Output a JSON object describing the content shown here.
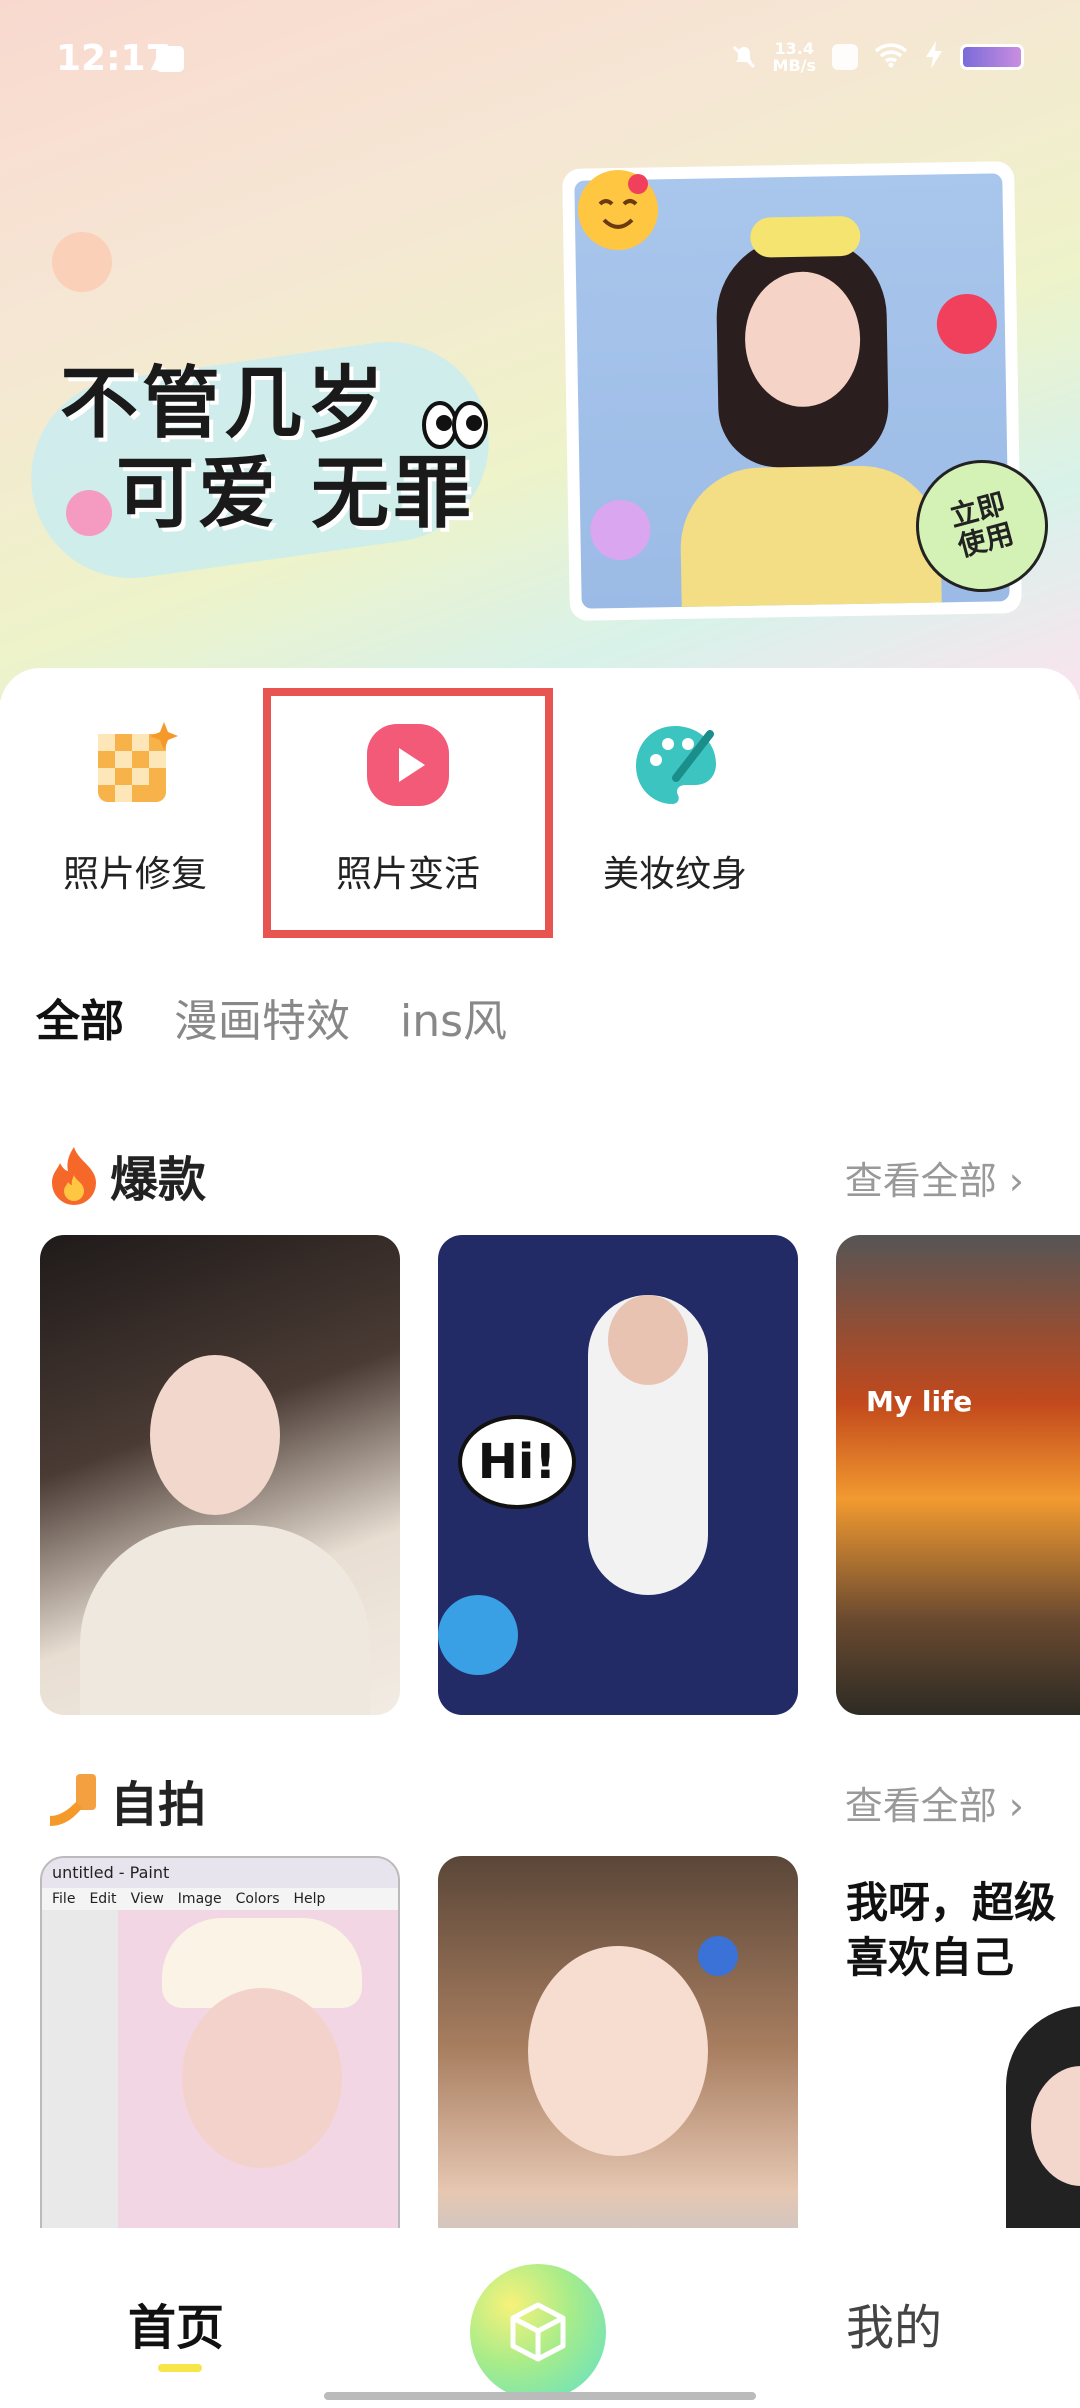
{
  "status_bar": {
    "time": "12:17",
    "net_speed_value": "13.4",
    "net_speed_unit": "MB/s"
  },
  "banner": {
    "slogan_line1": "不管几岁",
    "slogan_line2": "可爱 无罪",
    "cta_line1": "立即",
    "cta_line2": "使用"
  },
  "tools": [
    {
      "label": "照片修复",
      "icon": "photo-repair-icon"
    },
    {
      "label": "照片变活",
      "icon": "play-icon"
    },
    {
      "label": "美妆纹身",
      "icon": "palette-icon"
    }
  ],
  "tabs": [
    {
      "label": "全部",
      "active": true
    },
    {
      "label": "漫画特效",
      "active": false
    },
    {
      "label": "ins风",
      "active": false
    }
  ],
  "sections": [
    {
      "title": "爆款",
      "icon": "fire-icon",
      "more": "查看全部",
      "cards": [
        {
          "caption": ""
        },
        {
          "caption": "Hi!"
        },
        {
          "caption": "My life"
        }
      ]
    },
    {
      "title": "自拍",
      "icon": "selfie-icon",
      "more": "查看全部",
      "cards": [
        {
          "caption": "untitled - Paint",
          "menu": [
            "File",
            "Edit",
            "View",
            "Image",
            "Colors",
            "Help"
          ]
        },
        {
          "caption": ""
        },
        {
          "caption": "我呀，超级喜欢自己"
        }
      ]
    }
  ],
  "bottom_nav": {
    "home": "首页",
    "mine": "我的"
  },
  "colors": {
    "highlight_box": "#e85550",
    "accent_yellow": "#f7e54a",
    "play_button": "#f25a78"
  }
}
